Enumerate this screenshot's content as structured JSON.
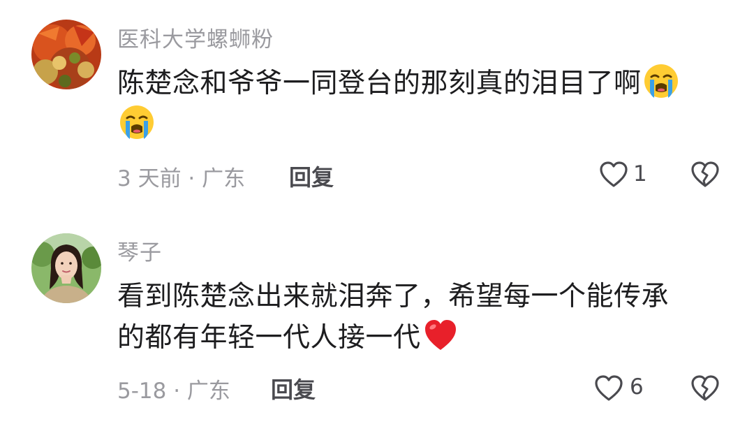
{
  "comments": [
    {
      "username": "医科大学螺蛳粉",
      "text_line1": "陈楚念和爷爷一同登台的那刻真的泪目了啊",
      "text_line1_emoji": "loudly-crying-face-emoji",
      "text_line2_emoji": "loudly-crying-face-emoji",
      "time_location": "3 天前 · 广东",
      "reply_label": "回复",
      "like_count": "1",
      "avatar_icon": "spicy-food-avatar"
    },
    {
      "username": "琴子",
      "text_line1": "看到陈楚念出来就泪奔了，希望每一个能传承",
      "text_line2": "的都有年轻一代人接一代",
      "text_line2_emoji": "red-heart-emoji",
      "time_location": "5-18 · 广东",
      "reply_label": "回复",
      "like_count": "6",
      "avatar_icon": "woman-portrait-avatar"
    }
  ],
  "icons": {
    "like": "heart-outline-icon",
    "dislike": "broken-heart-outline-icon"
  },
  "colors": {
    "primary_text": "#1d1d1f",
    "secondary_text": "#9a9a9f",
    "action_text": "#4a4a4f"
  }
}
